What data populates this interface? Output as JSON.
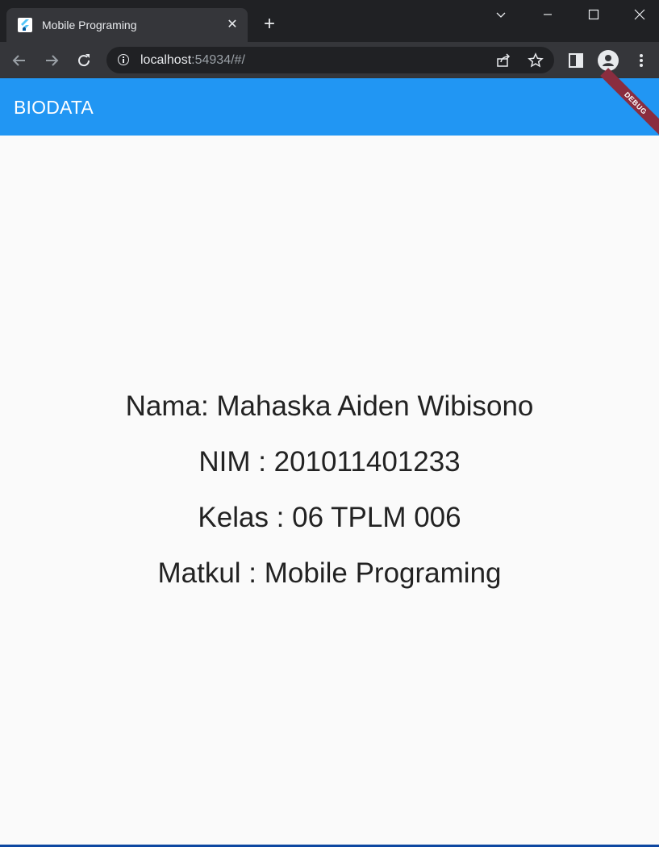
{
  "browser": {
    "tab_title": "Mobile Programing",
    "tab_close": "✕",
    "new_tab": "+",
    "url_host": "localhost",
    "url_rest": ":54934/#/"
  },
  "app": {
    "appbar_title": "BIODATA",
    "debug_label": "DEBUG",
    "accent_color": "#2196f3"
  },
  "biodata": {
    "nama": "Nama: Mahaska Aiden Wibisono",
    "nim": "NIM : 201011401233",
    "kelas": "Kelas : 06 TPLM 006",
    "matkul": "Matkul : Mobile Programing"
  }
}
